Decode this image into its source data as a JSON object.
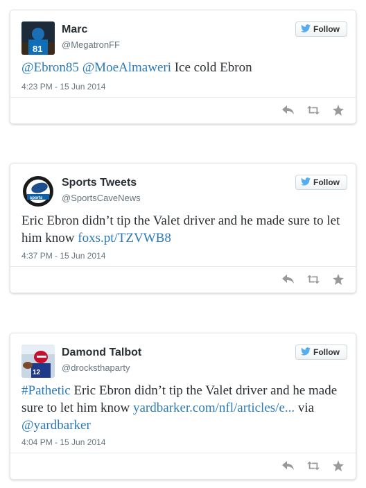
{
  "colors": {
    "link": "#2b7bb9",
    "icon": "#999999",
    "twitter_blue": "#55acee"
  },
  "follow_label": "Follow",
  "tweets": [
    {
      "name": "Marc",
      "handle": "@MegatronFF",
      "segments": [
        {
          "text": "@Ebron85",
          "link": true
        },
        {
          "text": " ",
          "link": false
        },
        {
          "text": "@MoeAlmaweri",
          "link": true
        },
        {
          "text": " Ice cold Ebron",
          "link": false
        }
      ],
      "timestamp": "4:23 PM - 15 Jun 2014"
    },
    {
      "name": "Sports Tweets",
      "handle": "@SportsCaveNews",
      "segments": [
        {
          "text": "Eric Ebron didn’t tip the Valet driver and he made sure to let him know ",
          "link": false
        },
        {
          "text": "foxs.pt/TZVWB8",
          "link": true
        }
      ],
      "timestamp": "4:37 PM - 15 Jun 2014"
    },
    {
      "name": "Damond Talbot",
      "handle": "@drocksthaparty",
      "segments": [
        {
          "text": "#Pathetic",
          "link": true
        },
        {
          "text": " Eric Ebron didn’t tip the Valet driver and he made sure to let him know ",
          "link": false
        },
        {
          "text": "yardbarker.com/nfl/articles/e...",
          "link": true
        },
        {
          "text": " via ",
          "link": false
        },
        {
          "text": "@yardbarker",
          "link": true
        }
      ],
      "timestamp": "4:04 PM - 15 Jun 2014"
    }
  ],
  "icons": {
    "reply": "reply-icon",
    "retweet": "retweet-icon",
    "favorite": "star-icon",
    "bird": "twitter-bird-icon"
  }
}
